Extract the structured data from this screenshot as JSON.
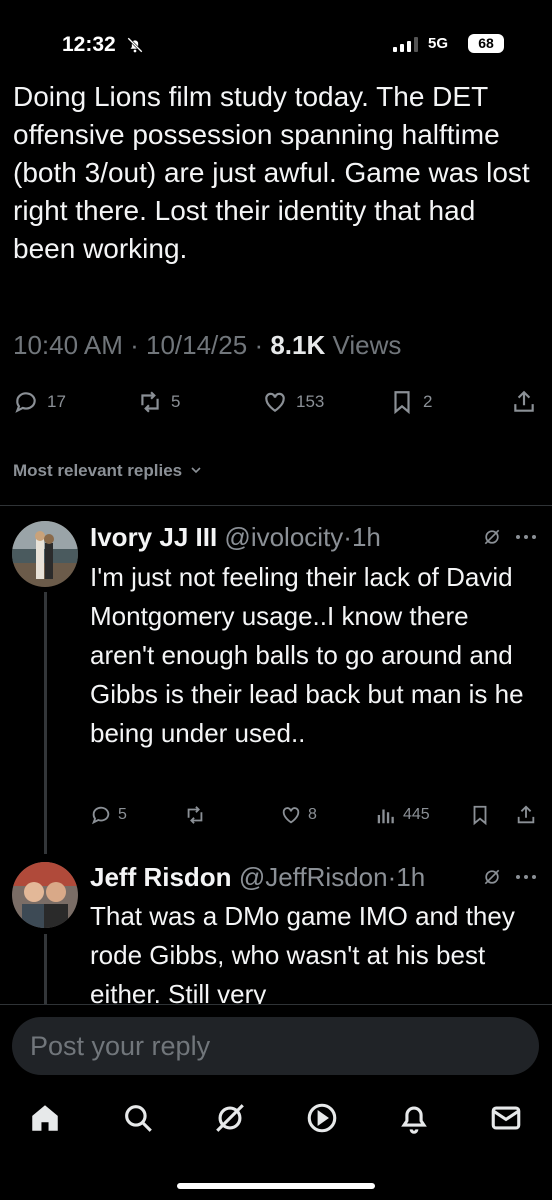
{
  "status": {
    "time": "12:32",
    "network": "5G",
    "battery": "68"
  },
  "tweet": {
    "text": "Doing Lions film study today. The DET offensive possession spanning halftime (both 3/out) are just awful. Game was lost right there. Lost their identity that had been working.",
    "time": "10:40 AM",
    "date": "10/14/25",
    "views_count": "8.1K",
    "views_label": "Views",
    "actions": {
      "replies": "17",
      "reposts": "5",
      "likes": "153",
      "bookmarks": "2"
    }
  },
  "replies_label": "Most relevant replies",
  "replies": [
    {
      "name": "Ivory JJ III",
      "handle": "@ivolocity",
      "time": "1h",
      "text": "I'm just not feeling their lack of David Montgomery usage..I know there aren't enough balls to go around and Gibbs is their lead back but man is he being under used..",
      "replies": "5",
      "reposts": "",
      "likes": "8",
      "views": "445"
    },
    {
      "name": "Jeff Risdon",
      "handle": "@JeffRisdon",
      "time": "1h",
      "text": "That was a DMo game IMO and they rode Gibbs, who wasn't at his best either. Still very"
    }
  ],
  "composer": {
    "placeholder": "Post your reply"
  },
  "tabs": [
    "home-icon",
    "search-icon",
    "grok-icon",
    "video-icon",
    "notifications-icon",
    "messages-icon"
  ],
  "colors": {
    "background": "#000000",
    "text": "#e7e9ea",
    "secondary": "#71767b"
  }
}
